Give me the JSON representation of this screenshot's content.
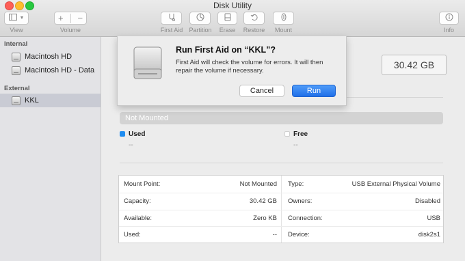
{
  "window": {
    "title": "Disk Utility"
  },
  "toolbar": {
    "view_label": "View",
    "volume_label": "Volume",
    "first_aid_label": "First Aid",
    "partition_label": "Partition",
    "erase_label": "Erase",
    "restore_label": "Restore",
    "mount_label": "Mount",
    "info_label": "Info"
  },
  "sidebar": {
    "internal_header": "Internal",
    "internal_items": [
      {
        "label": "Macintosh HD"
      },
      {
        "label": "Macintosh HD - Data"
      }
    ],
    "external_header": "External",
    "external_items": [
      {
        "label": "KKL",
        "selected": true
      }
    ]
  },
  "volume": {
    "capacity_display": "30.42 GB",
    "status_bar": "Not Mounted",
    "used_label": "Used",
    "used_value": "--",
    "free_label": "Free",
    "free_value": "--",
    "used_color": "#1e8cf0",
    "free_color": "#ffffff"
  },
  "info_table": {
    "left": [
      {
        "key": "Mount Point:",
        "value": "Not Mounted"
      },
      {
        "key": "Capacity:",
        "value": "30.42 GB"
      },
      {
        "key": "Available:",
        "value": "Zero KB"
      },
      {
        "key": "Used:",
        "value": "--"
      }
    ],
    "right": [
      {
        "key": "Type:",
        "value": "USB External Physical Volume"
      },
      {
        "key": "Owners:",
        "value": "Disabled"
      },
      {
        "key": "Connection:",
        "value": "USB"
      },
      {
        "key": "Device:",
        "value": "disk2s1"
      }
    ]
  },
  "dialog": {
    "title": "Run First Aid on “KKL”?",
    "message": "First Aid will check the volume for errors. It will then repair the volume if necessary.",
    "cancel_label": "Cancel",
    "run_label": "Run",
    "icon": "drive-icon"
  },
  "colors": {
    "accent": "#1f6fe8",
    "close": "#fd5f57",
    "minimize": "#febc2e",
    "zoom": "#28c840"
  }
}
